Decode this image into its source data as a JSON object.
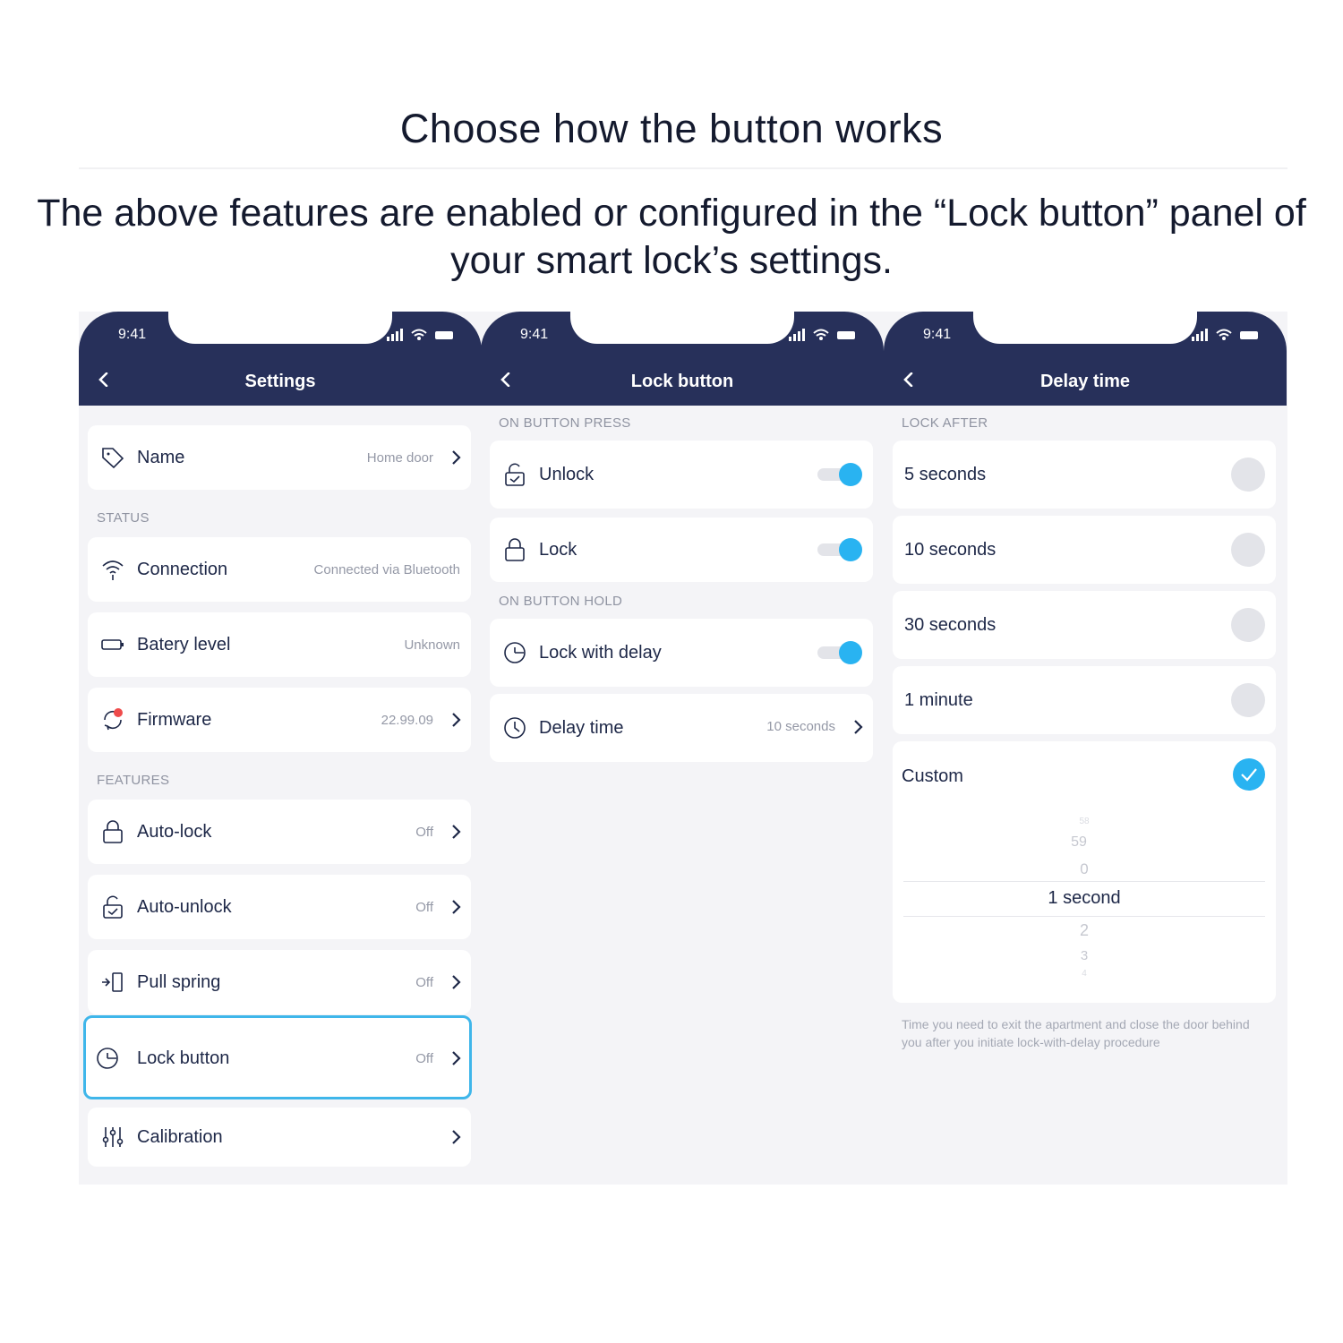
{
  "heading": "Choose how the button works",
  "subheading": "The above features are enabled or configured in the “Lock button” panel of your smart lock’s settings.",
  "status_time": "9:41",
  "settings": {
    "title": "Settings",
    "name_label": "Name",
    "name_value": "Home door",
    "status_section": "STATUS",
    "connection_label": "Connection",
    "connection_value": "Connected via Bluetooth",
    "battery_label": "Batery level",
    "battery_value": "Unknown",
    "firmware_label": "Firmware",
    "firmware_value": "22.99.09",
    "features_section": "FEATURES",
    "autolock_label": "Auto-lock",
    "autolock_value": "Off",
    "autounlock_label": "Auto-unlock",
    "autounlock_value": "Off",
    "pullspring_label": "Pull spring",
    "pullspring_value": "Off",
    "lockbutton_label": "Lock button",
    "lockbutton_value": "Off",
    "calibration_label": "Calibration"
  },
  "lock_button": {
    "title": "Lock button",
    "press_section": "ON BUTTON PRESS",
    "unlock_label": "Unlock",
    "unlock_on": true,
    "lock_label": "Lock",
    "lock_on": true,
    "hold_section": "ON BUTTON HOLD",
    "lockdelay_label": "Lock with delay",
    "lockdelay_on": true,
    "delaytime_label": "Delay time",
    "delaytime_value": "10 seconds"
  },
  "delay_time": {
    "title": "Delay time",
    "section": "LOCK AFTER",
    "options": [
      "5 seconds",
      "10 seconds",
      "30 seconds",
      "1 minute"
    ],
    "custom_label": "Custom",
    "custom_selected": true,
    "picker": [
      "58",
      "59",
      "0",
      "1 second",
      "2",
      "3",
      "4"
    ],
    "hint": "Time you need to exit the apartment and close the door behind you after you initiate lock-with-delay procedure"
  },
  "colors": {
    "header": "#27305a",
    "accent": "#29b3f1",
    "highlight_border": "#3fb6ea"
  }
}
